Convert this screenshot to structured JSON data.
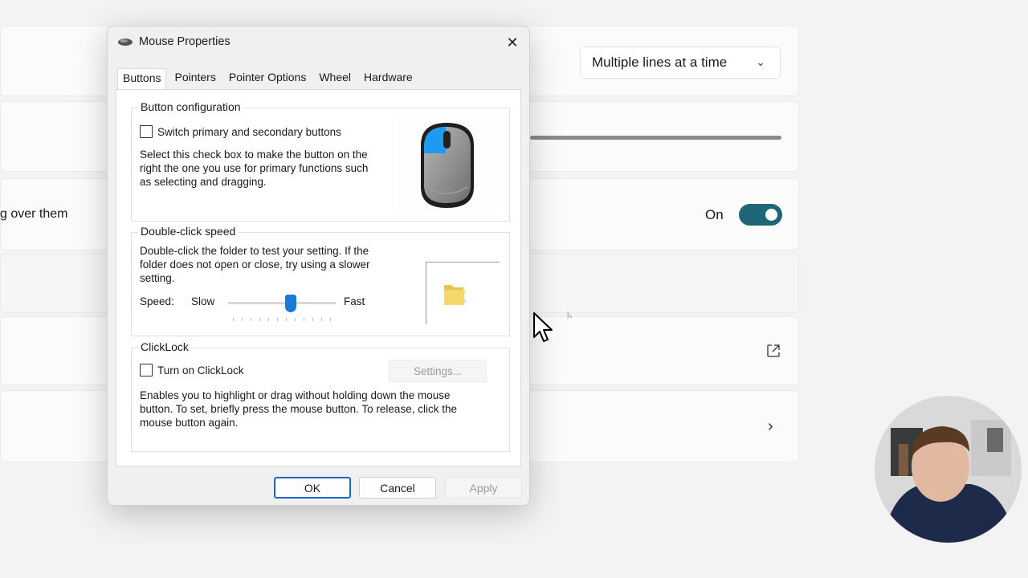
{
  "background": {
    "dropdown_value": "Multiple lines at a time",
    "partial_text": "g over them",
    "toggle_label": "On"
  },
  "dialog": {
    "title": "Mouse Properties",
    "tabs": [
      {
        "label": "Buttons",
        "active": true
      },
      {
        "label": "Pointers",
        "active": false
      },
      {
        "label": "Pointer Options",
        "active": false
      },
      {
        "label": "Wheel",
        "active": false
      },
      {
        "label": "Hardware",
        "active": false
      }
    ],
    "button_config": {
      "title": "Button configuration",
      "checkbox_label": "Switch primary and secondary buttons",
      "checked": false,
      "description_lines": [
        "Select this check box to make the button on the",
        "right the one you use for primary functions such",
        "as selecting and dragging."
      ]
    },
    "double_click": {
      "title": "Double-click speed",
      "description_lines": [
        "Double-click the folder to test your setting. If the",
        "folder does not open or close, try using a slower",
        "setting."
      ],
      "speed_label": "Speed:",
      "slow_label": "Slow",
      "fast_label": "Fast",
      "speed_value_fraction": 0.58
    },
    "clicklock": {
      "title": "ClickLock",
      "checkbox_label": "Turn on ClickLock",
      "checked": false,
      "settings_button": "Settings...",
      "description_lines": [
        "Enables you to highlight or drag without holding down the mouse",
        "button. To set, briefly press the mouse button. To release, click the",
        "mouse button again."
      ]
    },
    "buttons": {
      "ok": "OK",
      "cancel": "Cancel",
      "apply": "Apply"
    }
  },
  "colors": {
    "accent_blue": "#1a7ad4",
    "toggle_teal": "#1f6778"
  }
}
